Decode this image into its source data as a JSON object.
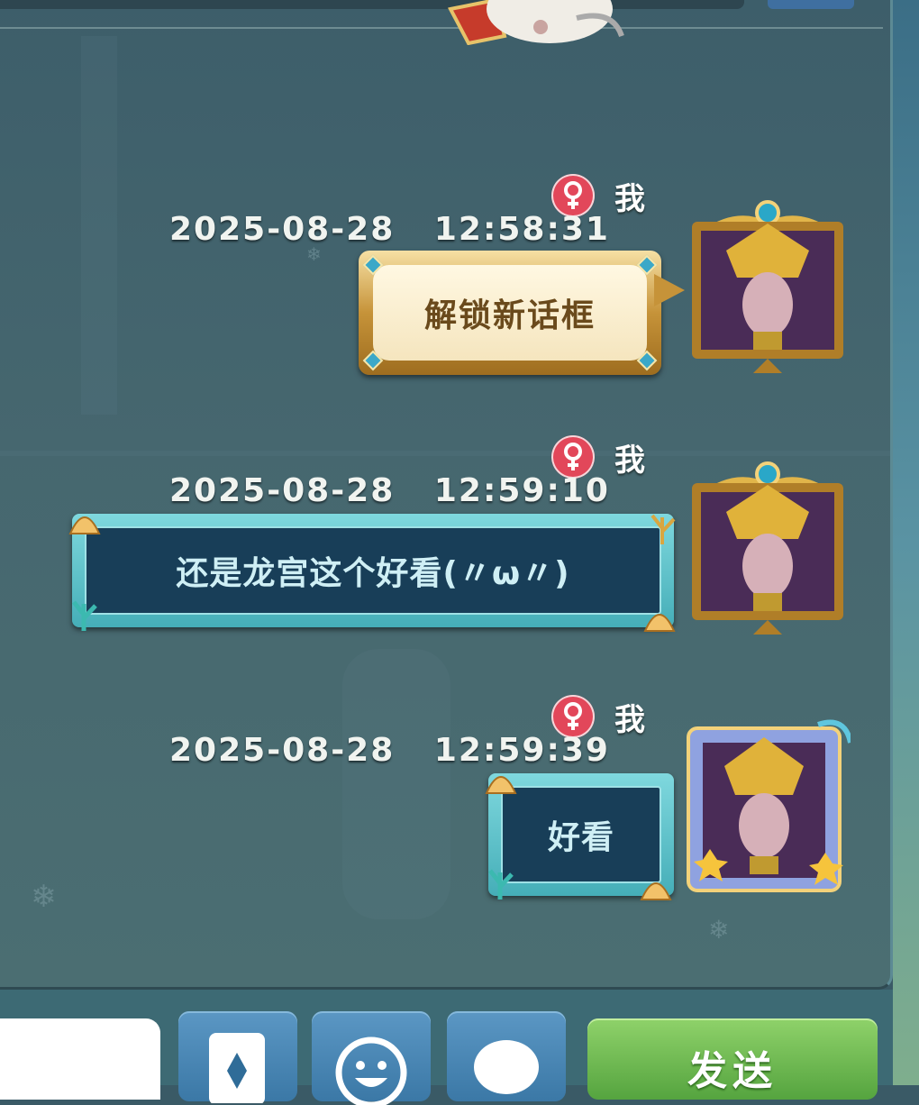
{
  "chat": {
    "messages": [
      {
        "sender": "我",
        "time": "2025-08-28   12:58:31",
        "text": "解锁新话框",
        "bubble": "gold"
      },
      {
        "sender": "我",
        "time": "2025-08-28   12:59:10",
        "text": "还是龙宫这个好看(〃ω〃)",
        "bubble": "sea"
      },
      {
        "sender": "我",
        "time": "2025-08-28   12:59:39",
        "text": "好看",
        "bubble": "sea"
      }
    ]
  },
  "toolbar": {
    "send_label": "发送",
    "icons": [
      "card-icon",
      "emoji-icon",
      "chat-bubble-icon"
    ]
  },
  "colors": {
    "panel_bg": "#46676f",
    "gender_female": "#e2475a",
    "send_button": "#55a43f",
    "tool_button": "#3b78a6",
    "gold_bubble": "#c69339",
    "sea_bubble": "#45aeb8"
  }
}
